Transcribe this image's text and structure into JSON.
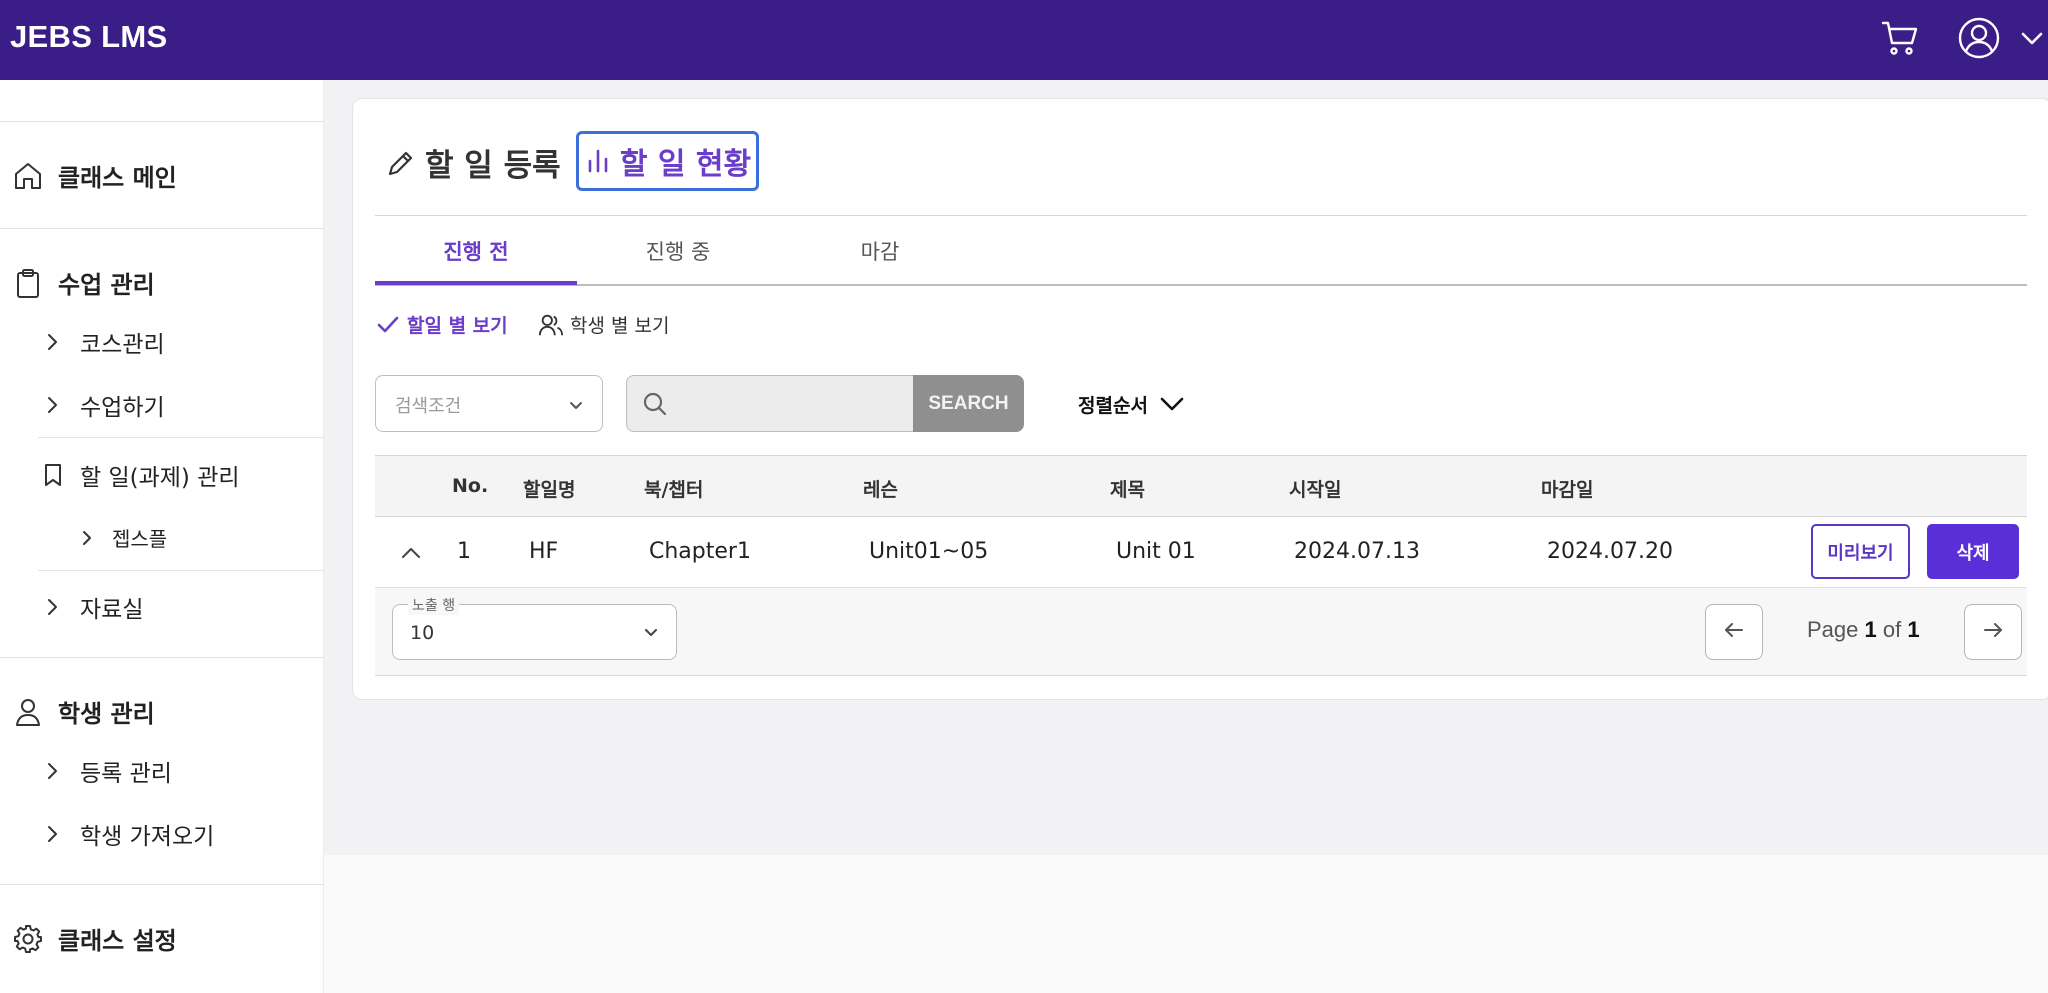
{
  "header": {
    "brand": "JEBS LMS",
    "bg_color": "#3b1d87",
    "icons": [
      "cart-icon",
      "user-icon",
      "chevron-down-icon"
    ]
  },
  "sidebar": {
    "class_main": "클래스 메인",
    "class_mgmt": "수업 관리",
    "course_mgmt": "코스관리",
    "lesson": "수업하기",
    "todo_mgmt": "할 일(과제) 관리",
    "jeps": "젭스플",
    "library": "자료실",
    "student_mgmt": "학생 관리",
    "registration": "등록 관리",
    "import_students": "학생 가져오기",
    "class_settings": "클래스 설정"
  },
  "main": {
    "title_register": "할 일 등록",
    "title_status": "할 일 현황",
    "tabs": [
      "진행 전",
      "진행 중",
      "마감"
    ],
    "active_tab": 0,
    "view_by_task": "할일 별 보기",
    "view_by_student": "학생 별 보기",
    "search_condition_placeholder": "검색조건",
    "search_input_value": "",
    "search_button": "SEARCH",
    "sort_label": "정렬순서",
    "accent_color": "#6a3ec9"
  },
  "table": {
    "headers": [
      "No.",
      "할일명",
      "북/챕터",
      "레슨",
      "제목",
      "시작일",
      "마감일"
    ],
    "rows": [
      {
        "no": "1",
        "name": "HF",
        "book": "Chapter1",
        "lesson": "Unit01~05",
        "title": "Unit 01",
        "start": "2024.07.13",
        "end": "2024.07.20",
        "preview_label": "미리보기",
        "delete_label": "삭제"
      }
    ]
  },
  "footer": {
    "rows_label": "노출 행",
    "rows_value": "10",
    "page_prefix": "Page",
    "page_current": "1",
    "page_of": "of",
    "page_total": "1"
  }
}
